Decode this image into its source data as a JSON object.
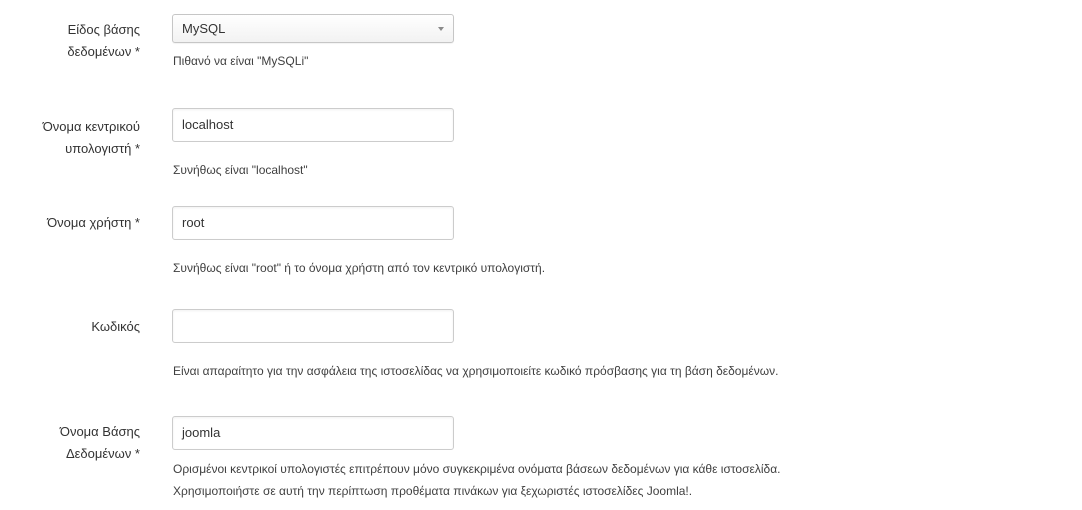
{
  "form": {
    "db_type": {
      "label_line1": "Είδος βάσης",
      "label_line2": "δεδομένων *",
      "value": "MySQL",
      "help": "Πιθανό να είναι \"MySQLi\""
    },
    "host": {
      "label_line1": "Όνομα κεντρικού",
      "label_line2": "υπολογιστή *",
      "value": "localhost",
      "help": "Συνήθως είναι \"localhost\""
    },
    "username": {
      "label": "Όνομα χρήστη *",
      "value": "root",
      "help": "Συνήθως είναι \"root\" ή το όνομα χρήστη από τον κεντρικό υπολογιστή."
    },
    "password": {
      "label": "Κωδικός",
      "value": "",
      "help": "Είναι απαραίτητο για την ασφάλεια της ιστοσελίδας να χρησιμοποιείτε κωδικό πρόσβασης για τη βάση δεδομένων."
    },
    "db_name": {
      "label_line1": "Όνομα Βάσης",
      "label_line2": "Δεδομένων *",
      "value": "joomla",
      "help_line1": "Ορισμένοι κεντρικοί υπολογιστές επιτρέπουν μόνο συγκεκριμένα ονόματα βάσεων δεδομένων για κάθε ιστοσελίδα.",
      "help_line2": "Χρησιμοποιήστε σε αυτή την περίπτωση προθέματα πινάκων για ξεχωριστές ιστοσελίδες Joomla!."
    }
  }
}
